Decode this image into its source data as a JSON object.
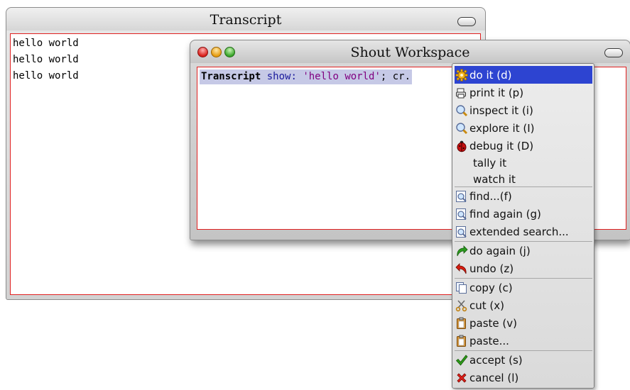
{
  "transcript": {
    "title": "Transcript",
    "lines": [
      "hello world",
      "hello world",
      "hello world"
    ]
  },
  "workspace": {
    "title": "Shout Workspace",
    "code": {
      "receiver": "Transcript",
      "selector": " show: ",
      "string": "'hello world'",
      "rest": "; cr."
    }
  },
  "menu": {
    "items": [
      {
        "label": "do it (d)",
        "icon": "gear-icon",
        "highlighted": true
      },
      {
        "label": "print it (p)",
        "icon": "printer-icon"
      },
      {
        "label": "inspect it (i)",
        "icon": "magnifier-icon"
      },
      {
        "label": "explore it (I)",
        "icon": "magnifier-icon"
      },
      {
        "label": "debug it (D)",
        "icon": "ladybug-icon"
      },
      {
        "label": "tally it",
        "icon": ""
      },
      {
        "label": "watch it",
        "icon": ""
      },
      {
        "label": "find...(f)",
        "icon": "find-icon"
      },
      {
        "label": "find again (g)",
        "icon": "find-icon"
      },
      {
        "label": "extended search...",
        "icon": "find-icon"
      },
      {
        "label": "do again (j)",
        "icon": "redo-arrow-icon"
      },
      {
        "label": "undo (z)",
        "icon": "undo-arrow-icon"
      },
      {
        "label": "copy (c)",
        "icon": "copy-icon"
      },
      {
        "label": "cut (x)",
        "icon": "scissors-icon"
      },
      {
        "label": "paste (v)",
        "icon": "clipboard-icon"
      },
      {
        "label": "paste...",
        "icon": "clipboard-icon"
      },
      {
        "label": "accept (s)",
        "icon": "checkmark-icon"
      },
      {
        "label": "cancel (l)",
        "icon": "x-mark-icon"
      }
    ]
  },
  "colors": {
    "highlight": "#2d44d1",
    "pane_border": "#e02020",
    "code_selection": "#c6c9e6"
  }
}
